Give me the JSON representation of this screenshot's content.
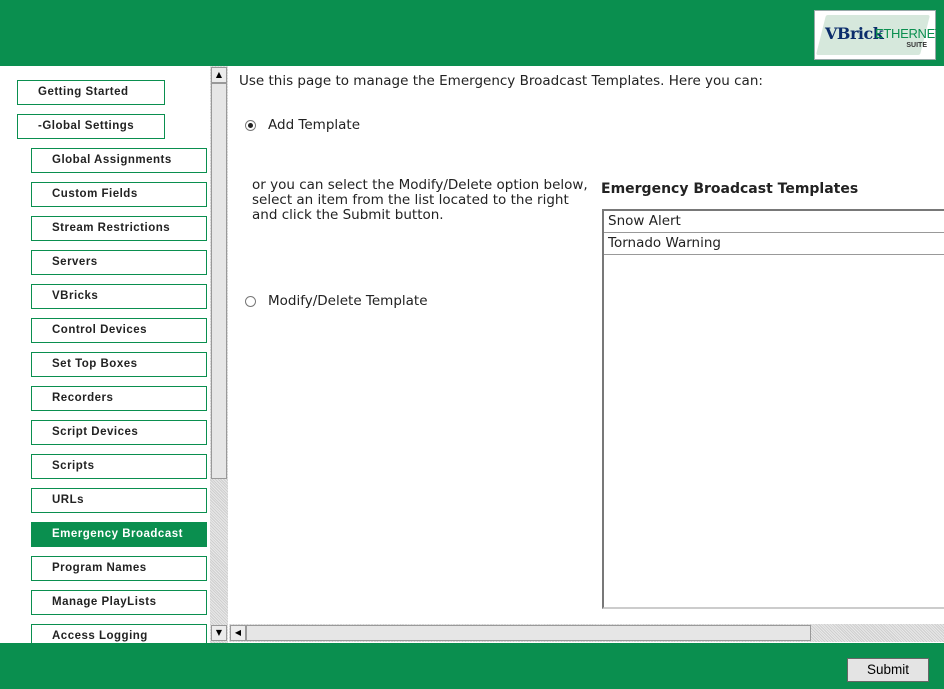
{
  "header": {
    "logo": {
      "brand": "VBrick",
      "product": "ETHERNETV",
      "suite": "SUITE"
    },
    "accent_color": "#0a8f4f"
  },
  "sidebar": {
    "items": [
      {
        "label": "Getting Started",
        "active": false
      },
      {
        "label": "-Global Settings",
        "active": false
      },
      {
        "label": "Global Assignments",
        "active": false
      },
      {
        "label": "Custom Fields",
        "active": false
      },
      {
        "label": "Stream Restrictions",
        "active": false
      },
      {
        "label": "Servers",
        "active": false
      },
      {
        "label": "VBricks",
        "active": false
      },
      {
        "label": "Control Devices",
        "active": false
      },
      {
        "label": "Set Top Boxes",
        "active": false
      },
      {
        "label": "Recorders",
        "active": false
      },
      {
        "label": "Script Devices",
        "active": false
      },
      {
        "label": "Scripts",
        "active": false
      },
      {
        "label": "URLs",
        "active": false
      },
      {
        "label": "Emergency Broadcast",
        "active": true
      },
      {
        "label": "Program Names",
        "active": false
      },
      {
        "label": "Manage PlayLists",
        "active": false
      },
      {
        "label": "Access Logging",
        "active": false
      }
    ]
  },
  "main": {
    "intro": "Use this page to manage the Emergency Broadcast Templates. Here you can:",
    "add_option": {
      "label": "Add Template",
      "checked": true
    },
    "modify_note": "or you can select the Modify/Delete option below, select an item from the list located to the right and click the Submit button.",
    "modify_option": {
      "label": "Modify/Delete Template",
      "checked": false
    },
    "templates_title": "Emergency Broadcast Templates",
    "templates": [
      "Snow Alert",
      "Tornado Warning"
    ]
  },
  "footer": {
    "submit_label": "Submit"
  }
}
